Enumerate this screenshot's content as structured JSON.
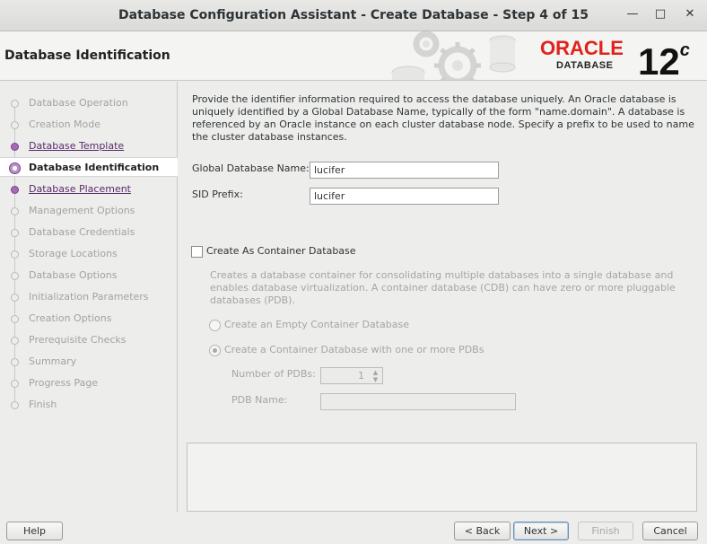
{
  "window": {
    "title": "Database Configuration Assistant - Create Database - Step 4 of 15",
    "minimize_glyph": "—",
    "maximize_glyph": "□",
    "close_glyph": "✕"
  },
  "header": {
    "page_title": "Database Identification",
    "logo_word": "ORACLE",
    "logo_product": "DATABASE",
    "version": "12",
    "version_suffix": "c"
  },
  "steps": [
    {
      "label": "Database Operation",
      "state": "done"
    },
    {
      "label": "Creation Mode",
      "state": "done"
    },
    {
      "label": "Database Template",
      "state": "link"
    },
    {
      "label": "Database Identification",
      "state": "active"
    },
    {
      "label": "Database Placement",
      "state": "link"
    },
    {
      "label": "Management Options",
      "state": "pending"
    },
    {
      "label": "Database Credentials",
      "state": "pending"
    },
    {
      "label": "Storage Locations",
      "state": "pending"
    },
    {
      "label": "Database Options",
      "state": "pending"
    },
    {
      "label": "Initialization Parameters",
      "state": "pending"
    },
    {
      "label": "Creation Options",
      "state": "pending"
    },
    {
      "label": "Prerequisite Checks",
      "state": "pending"
    },
    {
      "label": "Summary",
      "state": "pending"
    },
    {
      "label": "Progress Page",
      "state": "pending"
    },
    {
      "label": "Finish",
      "state": "pending"
    }
  ],
  "main": {
    "description": "Provide the identifier information required to access the database uniquely. An Oracle database is uniquely identified by a Global Database Name, typically of the form \"name.domain\". A database is referenced by an Oracle instance on each cluster database node. Specify a prefix to be used to name the cluster database instances.",
    "global_db_name_label": "Global Database Name:",
    "global_db_name_value": "lucifer",
    "sid_prefix_label": "SID Prefix:",
    "sid_prefix_value": "lucifer",
    "container_checkbox_label": "Create As Container Database",
    "container_checked": false,
    "container_description": "Creates a database container for consolidating multiple databases into a single database and enables database virtualization. A container database (CDB) can have zero or more pluggable databases (PDB).",
    "radio_empty_label": "Create an Empty Container Database",
    "radio_pdbs_label": "Create a Container Database with one or more PDBs",
    "num_pdbs_label": "Number of PDBs:",
    "num_pdbs_value": "1",
    "pdb_name_label": "PDB Name:",
    "pdb_name_value": ""
  },
  "buttons": {
    "help": "Help",
    "back": "< Back",
    "next": "Next >",
    "finish": "Finish",
    "cancel": "Cancel"
  }
}
